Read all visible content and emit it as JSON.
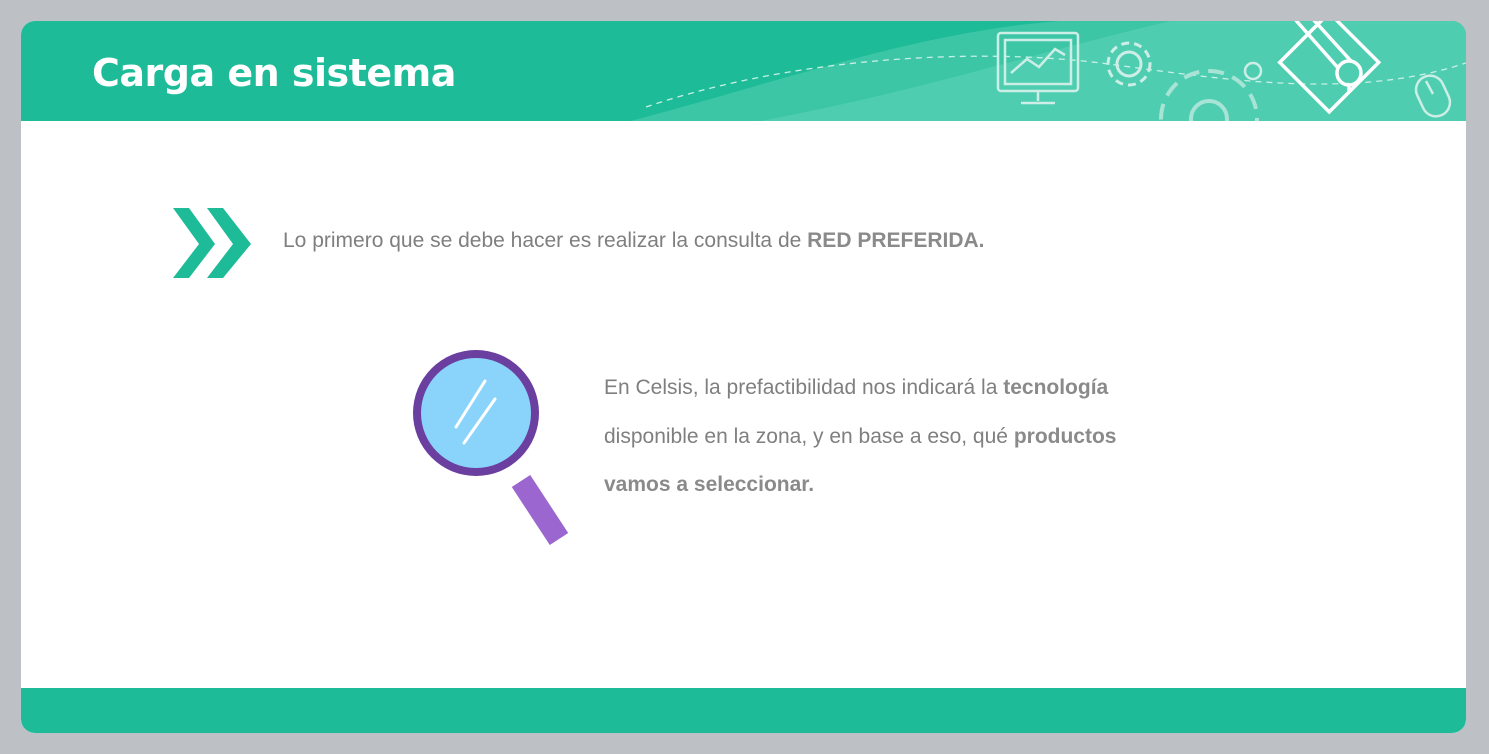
{
  "header": {
    "title": "Carga en sistema"
  },
  "intro": {
    "text": "Lo primero que se debe hacer es realizar la consulta de ",
    "bold": "RED PREFERIDA."
  },
  "paragraph": {
    "l1_text": "En Celsis, la prefactibilidad nos indicará la ",
    "l1_bold": "tecnología",
    "l2_text": "disponible en la zona, y en base a eso, qué ",
    "l2_bold": "productos",
    "l3_bold": "vamos a seleccionar."
  },
  "icons": {
    "header_deco": [
      "monitor-chart-icon",
      "gear-icon",
      "large-gear-icon",
      "document-pencil-icon",
      "mouse-icon"
    ],
    "bullet": "double-chevron-icon",
    "illustration": "magnifier-icon"
  },
  "colors": {
    "accent": "#1dbb98",
    "text": "#7f7f7f",
    "magnifier_ring": "#6a3f9f",
    "magnifier_glass": "#8ad4fb",
    "magnifier_handle": "#9b66cf",
    "background": "#bdc1c5"
  }
}
